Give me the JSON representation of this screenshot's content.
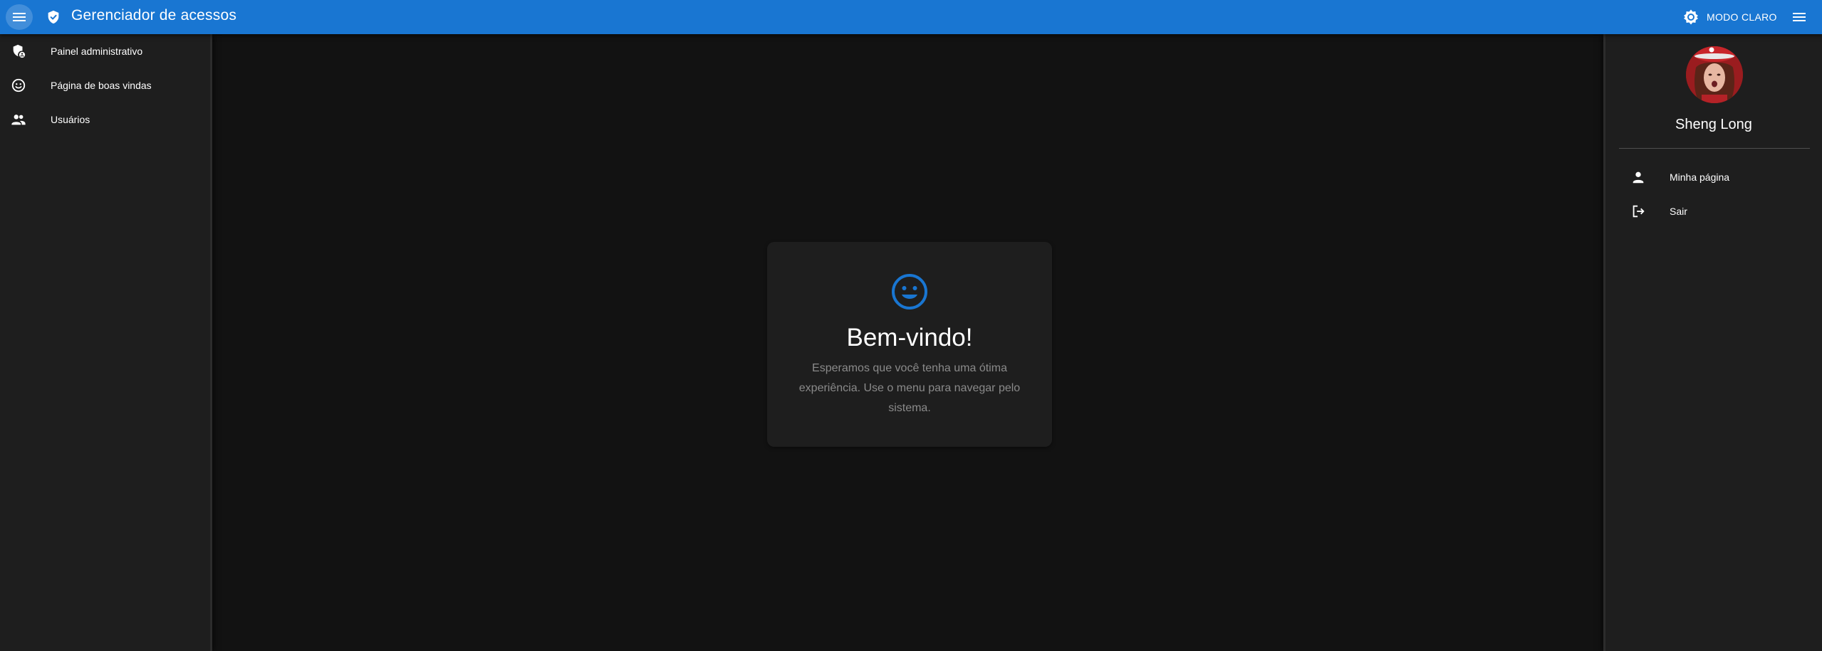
{
  "appbar": {
    "title": "Gerenciador de acessos",
    "theme_toggle_label": "MODO CLARO",
    "color": "#1976d2"
  },
  "left_drawer": {
    "items": [
      {
        "label": "Painel administrativo",
        "icon": "admin-panel-icon"
      },
      {
        "label": "Página de boas vindas",
        "icon": "smiley-icon"
      },
      {
        "label": "Usuários",
        "icon": "people-icon"
      }
    ]
  },
  "right_drawer": {
    "user_name": "Sheng Long",
    "items": [
      {
        "label": "Minha página",
        "icon": "person-icon"
      },
      {
        "label": "Sair",
        "icon": "logout-icon"
      }
    ]
  },
  "welcome": {
    "title": "Bem-vindo!",
    "message": "Esperamos que você tenha uma ótima experiência. Use o menu para navegar pelo sistema.",
    "icon": "smiley-icon",
    "accent": "#1976d2"
  }
}
